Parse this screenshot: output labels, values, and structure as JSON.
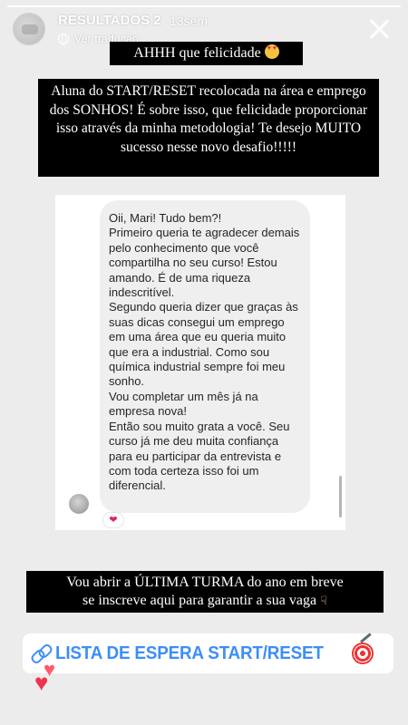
{
  "story": {
    "progress_value": 1.0,
    "account_name": "RESULTADOS 2",
    "timestamp": "13sem",
    "translate_label": "Ver tradução"
  },
  "captions": {
    "top": "AHHH que felicidade",
    "middle": "Aluna do START/RESET  recolocada na área e emprego dos SONHOS! É sobre isso, que felicidade proporcionar isso através da minha metodologia! Te desejo MUITO sucesso nesse novo desafio!!!!!",
    "bottom_line1": "Vou abrir a ÚLTIMA TURMA do ano em breve",
    "bottom_line2": "se inscreve aqui para garantir a sua vaga"
  },
  "message": {
    "paragraphs": [
      "Oii, Mari! Tudo bem?!",
      "Primeiro queria te agradecer demais pelo conhecimento que você compartilha no seu curso! Estou amando. É de uma riqueza indescritível.",
      "Segundo queria dizer que graças às suas dicas consegui um emprego em uma área que eu queria muito que era a industrial. Como sou química industrial sempre foi meu sonho.",
      "Vou completar um mês já na empresa nova!",
      "Então sou muito grata a você. Seu curso já me deu muita confiança para eu participar da entrevista e com toda certeza isso foi um diferencial."
    ],
    "reaction": "❤"
  },
  "link_sticker": {
    "label": "LISTA DE ESPERA START/RESET"
  },
  "icons": {
    "close": "close-icon",
    "globe": "globe-icon",
    "heart_eyes": "heart-eyes-emoji",
    "pointing_down": "pointing-down-emoji",
    "link": "link-icon",
    "target": "target-icon",
    "hearts": "hearts-sticker"
  },
  "colors": {
    "background": "#ececec",
    "caption_bg": "#000000",
    "link_blue": "#3d8ef7",
    "bubble_bg": "#efefef"
  }
}
